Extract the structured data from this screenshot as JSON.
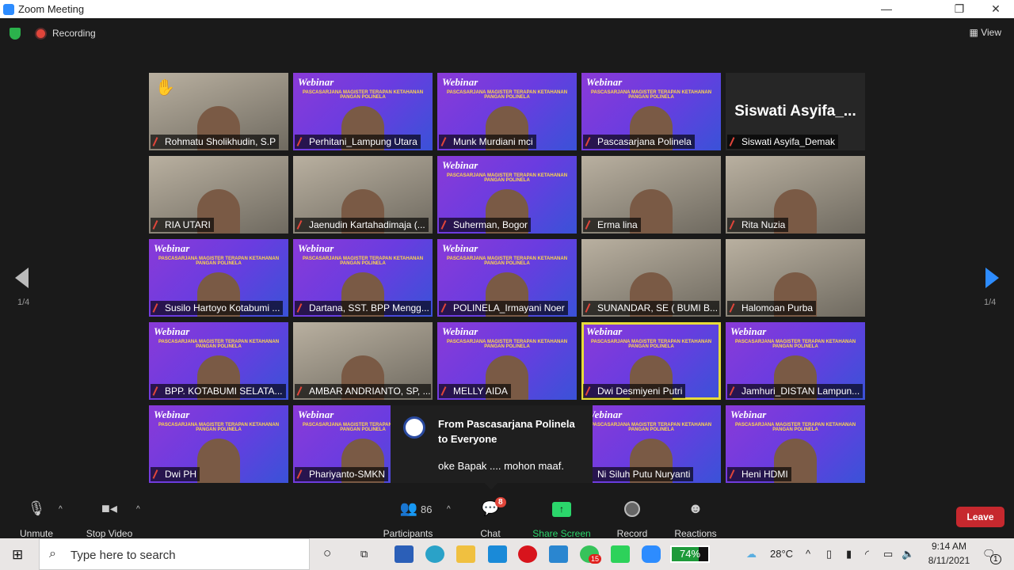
{
  "window": {
    "title": "Zoom Meeting",
    "minimize": "—",
    "restore": "❐",
    "close": "✕"
  },
  "meeting": {
    "recording_label": "Recording",
    "view_label": "View",
    "page_indicator": "1/4"
  },
  "tiles": [
    {
      "name": "Rohmatu Sholikhudin, S.P",
      "style": "cam",
      "hand": "✋"
    },
    {
      "name": "Perhitani_Lampung Utara",
      "style": "webinar"
    },
    {
      "name": "Munk Murdiani mci",
      "style": "webinar"
    },
    {
      "name": "Pascasarjana Polinela",
      "style": "webinar"
    },
    {
      "name": "Siswati Asyifa_Demak",
      "style": "none",
      "display": "Siswati  Asyifa_..."
    },
    {
      "name": "RIA UTARI",
      "style": "cam"
    },
    {
      "name": "Jaenudin Kartahadimaja (...",
      "style": "cam"
    },
    {
      "name": "Suherman, Bogor",
      "style": "webinar"
    },
    {
      "name": "Erma lina",
      "style": "cam"
    },
    {
      "name": "Rita Nuzia",
      "style": "cam"
    },
    {
      "name": "Susilo Hartoyo Kotabumi ...",
      "style": "webinar"
    },
    {
      "name": "Dartana, SST. BPP Mengg...",
      "style": "webinar"
    },
    {
      "name": "POLINELA_Irmayani Noer",
      "style": "webinar"
    },
    {
      "name": "SUNANDAR, SE ( BUMI B...",
      "style": "cam"
    },
    {
      "name": "Halomoan Purba",
      "style": "cam"
    },
    {
      "name": "BPP. KOTABUMI  SELATA...",
      "style": "webinar"
    },
    {
      "name": "AMBAR ANDRIANTO, SP, ...",
      "style": "cam"
    },
    {
      "name": "MELLY AIDA",
      "style": "webinar"
    },
    {
      "name": "Dwi Desmiyeni Putri",
      "style": "webinar",
      "speaking": true
    },
    {
      "name": "Jamhuri_DISTAN Lampun...",
      "style": "webinar"
    },
    {
      "name": "Dwi PH",
      "style": "webinar"
    },
    {
      "name": "Phariyanto-SMKN",
      "style": "webinar"
    },
    {
      "name": "",
      "style": "webinar"
    },
    {
      "name": "Ni Siluh Putu Nuryanti",
      "style": "webinar"
    },
    {
      "name": "Heni HDMI",
      "style": "webinar"
    }
  ],
  "webinar_text": {
    "title": "Webinar",
    "band": "PASCASARJANA MAGISTER TERAPAN KETAHANAN PANGAN POLINELA"
  },
  "chat_popup": {
    "from": "From Pascasarjana Polinela",
    "to": "to Everyone",
    "message": "oke Bapak .... mohon maaf."
  },
  "toolbar": {
    "unmute": "Unmute",
    "stop_video": "Stop Video",
    "participants": "Participants",
    "participants_count": "86",
    "chat": "Chat",
    "chat_badge": "8",
    "share_screen": "Share Screen",
    "record": "Record",
    "reactions": "Reactions",
    "leave": "Leave",
    "share_color": "#2bd66b",
    "leave_color": "#c6282e"
  },
  "taskbar": {
    "search_placeholder": "Type here to search",
    "battery": "74%",
    "weather": "28°C",
    "time": "9:14 AM",
    "date": "8/11/2021",
    "whatsapp_badge": "15",
    "notifications": "1"
  }
}
